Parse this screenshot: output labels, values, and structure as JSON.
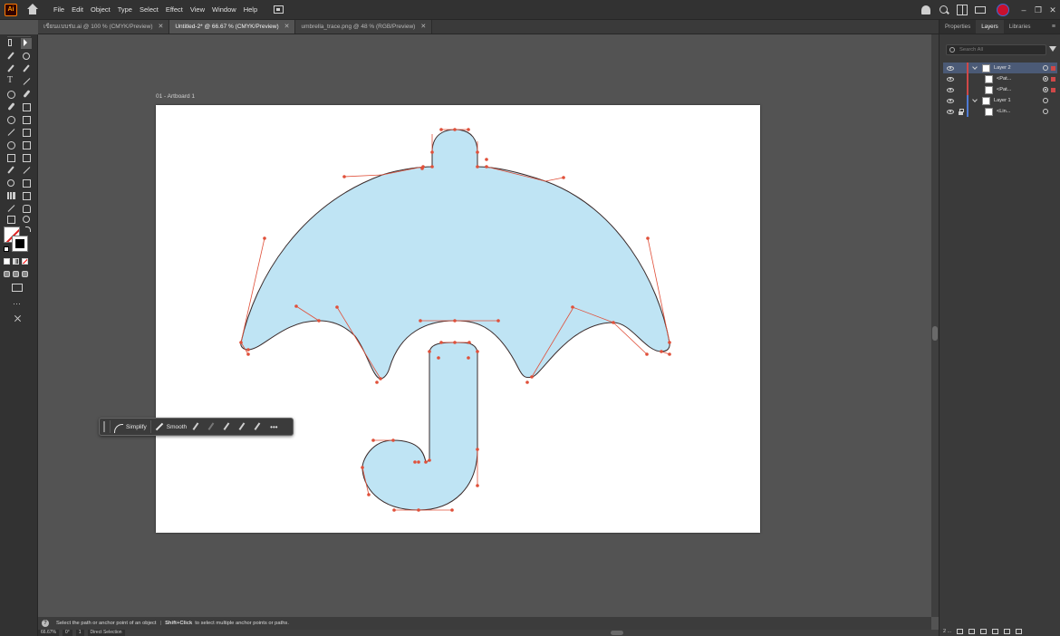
{
  "app": {
    "logo_text": "Ai",
    "menu": [
      "File",
      "Edit",
      "Object",
      "Type",
      "Select",
      "Effect",
      "View",
      "Window",
      "Help"
    ]
  },
  "tabs": [
    {
      "label": "เขียนแบบร่ม.ai @ 100 % (CMYK/Preview)",
      "active": false
    },
    {
      "label": "Untitled-2* @ 66.67 % (CMYK/Preview)",
      "active": true
    },
    {
      "label": "umbrella_trace.png @ 48 % (RGB/Preview)",
      "active": false
    }
  ],
  "window_controls": {
    "minimize": "–",
    "restore": "❐",
    "close": "✕"
  },
  "artboard": {
    "label": "01 - Artboard 1"
  },
  "icons": {
    "fill_color": "#bfe4f4",
    "stroke_color": "#3a2a2a",
    "anchor_color": "#e0503a",
    "handle_color": "#e0503a"
  },
  "task_bar": {
    "simplify": "Simplify",
    "smooth": "Smooth",
    "more": "•••"
  },
  "status": {
    "help": "?",
    "hint_part1": "Select the path or anchor point of an object",
    "separator": "|",
    "hint_bold": "Shift+Click",
    "hint_part2": "to select multiple anchor points or paths.",
    "zoom": "66.67%",
    "rotate": "0°",
    "artboard_index": "1",
    "tool_name": "Direct Selection"
  },
  "right_panel": {
    "tabs": [
      "Properties",
      "Layers",
      "Libraries"
    ],
    "active_tab": "Layers",
    "menu": "≡",
    "search_placeholder": "Search All",
    "layers": [
      {
        "name": "Layer 2",
        "level": 0,
        "selected": true,
        "color": "#d04848",
        "locked": false
      },
      {
        "name": "<Pat...",
        "level": 1,
        "selected": false,
        "color": "#d04848",
        "locked": false
      },
      {
        "name": "<Pat...",
        "level": 1,
        "selected": false,
        "color": "#d04848",
        "locked": false
      },
      {
        "name": "Layer 1",
        "level": 0,
        "selected": false,
        "color": "#4f7bd4",
        "locked": false
      },
      {
        "name": "<Lin...",
        "level": 1,
        "selected": false,
        "color": "#4f7bd4",
        "locked": true
      }
    ],
    "footer_count": "2 ..."
  }
}
